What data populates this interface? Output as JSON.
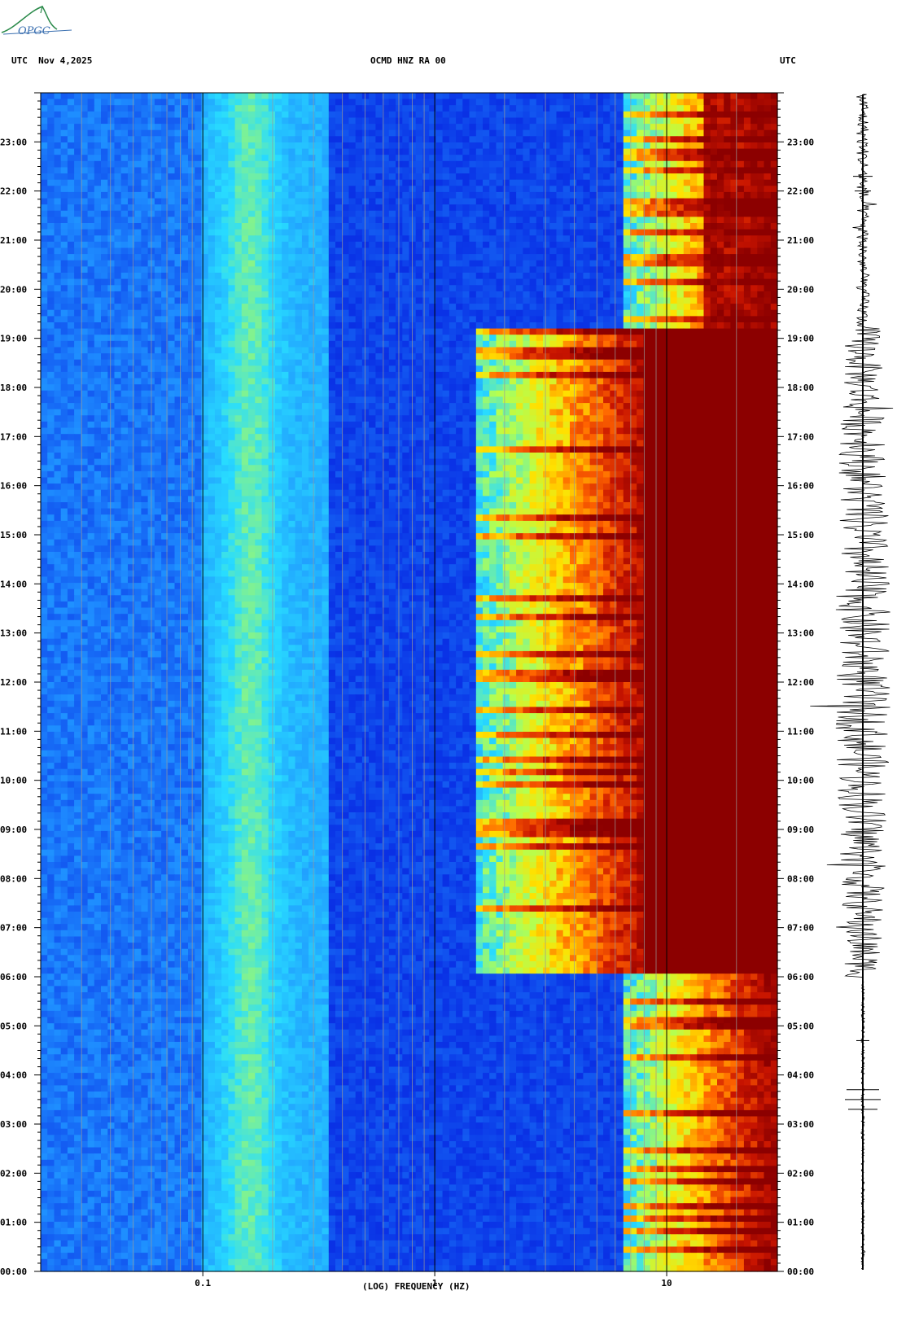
{
  "header": {
    "left": "UTC  Nov 4,2025",
    "center": "OCMD HNZ RA 00",
    "right": "UTC",
    "logo_text": "OPGC"
  },
  "chart_data": {
    "type": "heatmap",
    "title": "OCMD HNZ RA 00",
    "date": "Nov 4,2025",
    "xlabel": "(LOG) FREQUENCY (HZ)",
    "x_scale": "log",
    "x_range_hz": [
      0.02,
      30
    ],
    "x_ticks": [
      {
        "value": 0.1,
        "label": "0.1"
      },
      {
        "value": 1,
        "label": "1"
      },
      {
        "value": 10,
        "label": "10"
      }
    ],
    "y_label_left": "UTC",
    "y_label_right": "UTC",
    "y_range_hours": [
      0,
      24
    ],
    "y_ticks": [
      {
        "value": 0,
        "label": "00:00"
      },
      {
        "value": 1,
        "label": "01:00"
      },
      {
        "value": 2,
        "label": "02:00"
      },
      {
        "value": 3,
        "label": "03:00"
      },
      {
        "value": 4,
        "label": "04:00"
      },
      {
        "value": 5,
        "label": "05:00"
      },
      {
        "value": 6,
        "label": "06:00"
      },
      {
        "value": 7,
        "label": "07:00"
      },
      {
        "value": 8,
        "label": "08:00"
      },
      {
        "value": 9,
        "label": "09:00"
      },
      {
        "value": 10,
        "label": "10:00"
      },
      {
        "value": 11,
        "label": "11:00"
      },
      {
        "value": 12,
        "label": "12:00"
      },
      {
        "value": 13,
        "label": "13:00"
      },
      {
        "value": 14,
        "label": "14:00"
      },
      {
        "value": 15,
        "label": "15:00"
      },
      {
        "value": 16,
        "label": "16:00"
      },
      {
        "value": 17,
        "label": "17:00"
      },
      {
        "value": 18,
        "label": "18:00"
      },
      {
        "value": 19,
        "label": "19:00"
      },
      {
        "value": 20,
        "label": "20:00"
      },
      {
        "value": 21,
        "label": "21:00"
      },
      {
        "value": 22,
        "label": "22:00"
      },
      {
        "value": 23,
        "label": "23:00"
      }
    ],
    "colormap": [
      "#0000a8",
      "#0a32e6",
      "#1e8cff",
      "#28dcff",
      "#b4ff50",
      "#ffe100",
      "#ff6400",
      "#c81400",
      "#8c0000"
    ],
    "daytime_high_noise_hours": [
      6,
      19.2
    ],
    "strong_noise_onset_hz": {
      "night": 6.5,
      "day": 1.5
    }
  },
  "seismogram": {
    "color": "#000000"
  }
}
